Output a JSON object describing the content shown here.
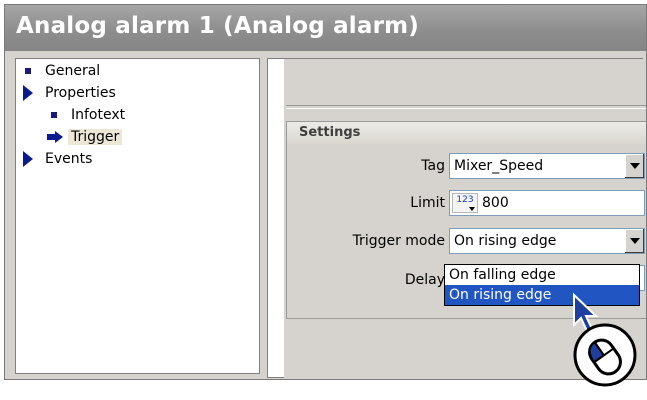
{
  "window": {
    "title": "Analog alarm 1 (Analog alarm)"
  },
  "tree": {
    "items": [
      {
        "label": "General",
        "icon": "square-bullet-icon"
      },
      {
        "label": "Properties",
        "icon": "expand-triangle-icon"
      },
      {
        "label": "Infotext",
        "icon": "square-bullet-icon"
      },
      {
        "label": "Trigger",
        "icon": "arrow-right-icon",
        "selected": true
      },
      {
        "label": "Events",
        "icon": "expand-triangle-icon"
      }
    ]
  },
  "settings": {
    "header": "Settings",
    "tag": {
      "label": "Tag",
      "value": "Mixer_Speed"
    },
    "limit": {
      "label": "Limit",
      "value": "800",
      "icon_text": "123"
    },
    "trigger_mode": {
      "label": "Trigger mode",
      "value": "On rising edge"
    },
    "delay": {
      "label": "Delay"
    }
  },
  "dropdown": {
    "options": [
      {
        "label": "On falling edge",
        "highlighted": false
      },
      {
        "label": "On rising edge",
        "highlighted": true
      }
    ]
  },
  "colors": {
    "title_bar": "#8e8e8e",
    "highlight": "#2156c2",
    "tree_icon": "#0a1a8f"
  }
}
